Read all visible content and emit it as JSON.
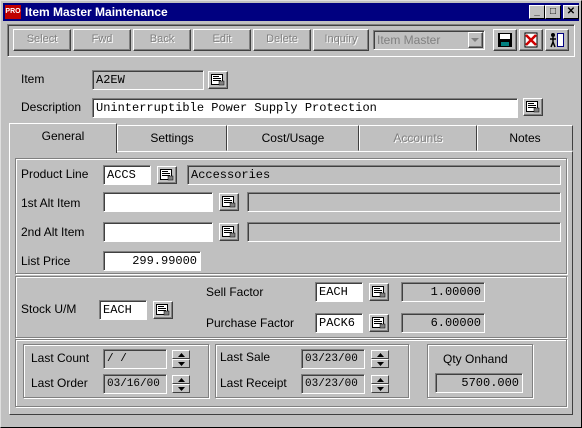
{
  "window": {
    "icon_text": "PRO",
    "title": "Item Master Maintenance",
    "minimize_glyph": "_",
    "maximize_glyph": "□",
    "close_glyph": "✕"
  },
  "toolbar": {
    "select_label": "Select",
    "fwd_label": "Fwd",
    "back_label": "Back",
    "edit_label": "Edit",
    "delete_label": "Delete",
    "inquiry_label": "Inquiry",
    "mode_select": "Item Master"
  },
  "header": {
    "item_label": "Item",
    "item_value": "A2EW",
    "description_label": "Description",
    "description_value": "Uninterruptible Power Supply Protection"
  },
  "tabs": [
    {
      "label": "General"
    },
    {
      "label": "Settings"
    },
    {
      "label": "Cost/Usage"
    },
    {
      "label": "Accounts"
    },
    {
      "label": "Notes"
    }
  ],
  "general": {
    "product_line_label": "Product Line",
    "product_line_code": "ACCS",
    "product_line_desc": "Accessories",
    "alt1_label": "1st Alt Item",
    "alt1_value": "",
    "alt1_desc": "",
    "alt2_label": "2nd Alt Item",
    "alt2_value": "",
    "alt2_desc": "",
    "list_price_label": "List Price",
    "list_price_value": "299.99000",
    "stock_um_label": "Stock U/M",
    "stock_um_value": "EACH",
    "sell_factor_label": "Sell Factor",
    "sell_factor_um": "EACH",
    "sell_factor_value": "1.00000",
    "purchase_factor_label": "Purchase Factor",
    "purchase_factor_um": "PACK6",
    "purchase_factor_value": "6.00000",
    "last_count_label": "Last Count",
    "last_count_value": " /  /",
    "last_order_label": "Last Order",
    "last_order_value": "03/16/00",
    "last_sale_label": "Last Sale",
    "last_sale_value": "03/23/00",
    "last_receipt_label": "Last Receipt",
    "last_receipt_value": "03/23/00",
    "qty_onhand_label": "Qty Onhand",
    "qty_onhand_value": "5700.000"
  },
  "colors": {
    "title_bar": "#000080",
    "face": "#c0c0c0",
    "icon_red": "#c00000"
  }
}
